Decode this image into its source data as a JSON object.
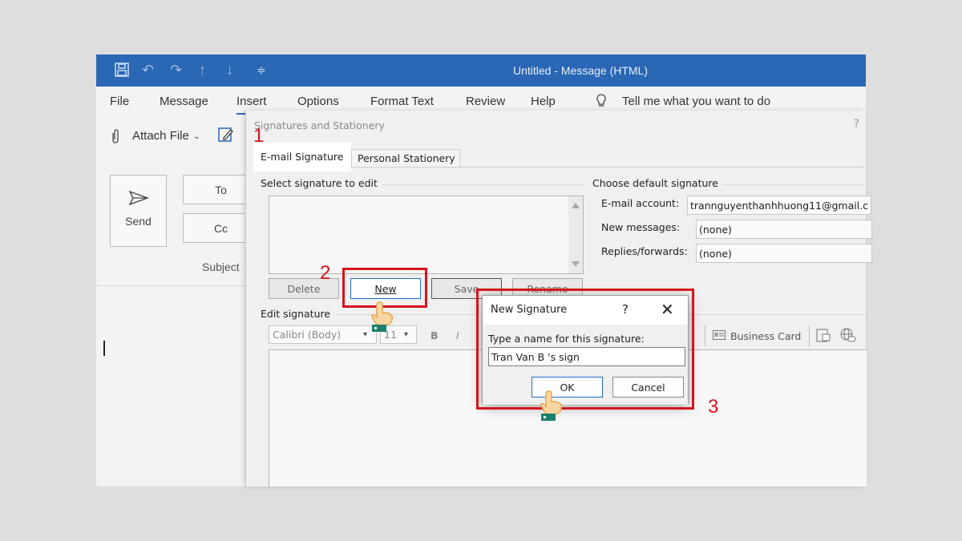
{
  "window": {
    "title": "Untitled  -  Message (HTML)"
  },
  "menu": [
    "File",
    "Message",
    "Insert",
    "Options",
    "Format Text",
    "Review",
    "Help"
  ],
  "tell_me": "Tell me what you want to do",
  "ribbon": {
    "attach_file": "Attach File",
    "send": "Send",
    "to": "To",
    "cc": "Cc",
    "subject": "Subject"
  },
  "sig_dialog": {
    "title": "Signatures and Stationery",
    "help": "?",
    "tabs": [
      "E-mail Signature",
      "Personal Stationery"
    ],
    "select_label": "Select signature to edit",
    "buttons": {
      "delete": "Delete",
      "new": "New",
      "save": "Save",
      "rename": "Rename"
    },
    "edit_label": "Edit signature",
    "font": "Calibri (Body)",
    "size": "11",
    "bold": "B",
    "italic": "I",
    "business_card": "Business Card",
    "default_label": "Choose default signature",
    "email_account_label": "E-mail account:",
    "email_account_value": "trannguyenthanhhuong11@gmail.c",
    "new_messages_label": "New messages:",
    "new_messages_value": "(none)",
    "replies_label": "Replies/forwards:",
    "replies_value": "(none)"
  },
  "new_sig_dialog": {
    "title": "New Signature",
    "help": "?",
    "close": "✕",
    "prompt": "Type a name for this signature:",
    "value": "Tran Van B 's sign",
    "ok": "OK",
    "cancel": "Cancel"
  },
  "step_numbers": [
    "1",
    "2",
    "3"
  ],
  "colors": {
    "accent": "#2a67b4",
    "highlight": "#d6141b"
  }
}
